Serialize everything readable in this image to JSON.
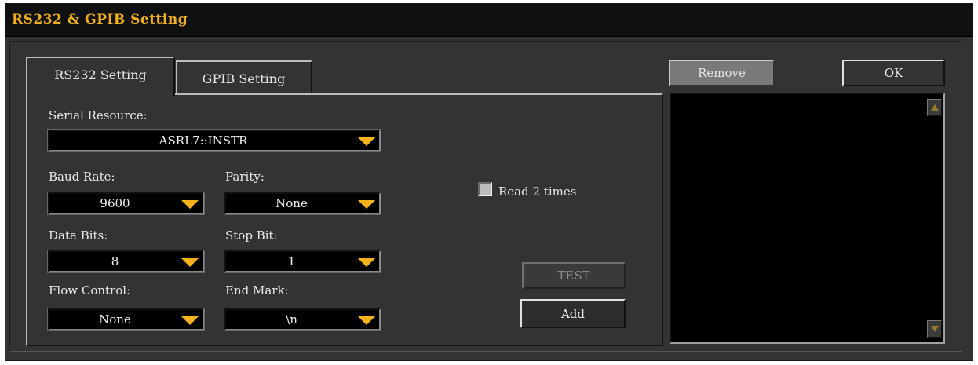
{
  "window": {
    "title": "RS232 & GPIB Setting"
  },
  "tabs": [
    {
      "label": "RS232 Setting",
      "active": true
    },
    {
      "label": "GPIB Setting",
      "active": false
    }
  ],
  "rs232": {
    "serial_resource": {
      "label": "Serial Resource:",
      "value": "ASRL7::INSTR"
    },
    "baud_rate": {
      "label": "Baud Rate:",
      "value": "9600"
    },
    "parity": {
      "label": "Parity:",
      "value": "None"
    },
    "data_bits": {
      "label": "Data Bits:",
      "value": "8"
    },
    "stop_bit": {
      "label": "Stop Bit:",
      "value": "1"
    },
    "flow_control": {
      "label": "Flow Control:",
      "value": "None"
    },
    "end_mark": {
      "label": "End Mark:",
      "value": "\\n"
    },
    "read_twice": {
      "label": "Read 2 times",
      "checked": false
    },
    "test_label": "TEST",
    "add_label": "Add"
  },
  "right_panel": {
    "remove_label": "Remove",
    "ok_label": "OK"
  },
  "colors": {
    "title": "#f0b020",
    "arrow": "#f5b21a",
    "background": "#333333"
  }
}
